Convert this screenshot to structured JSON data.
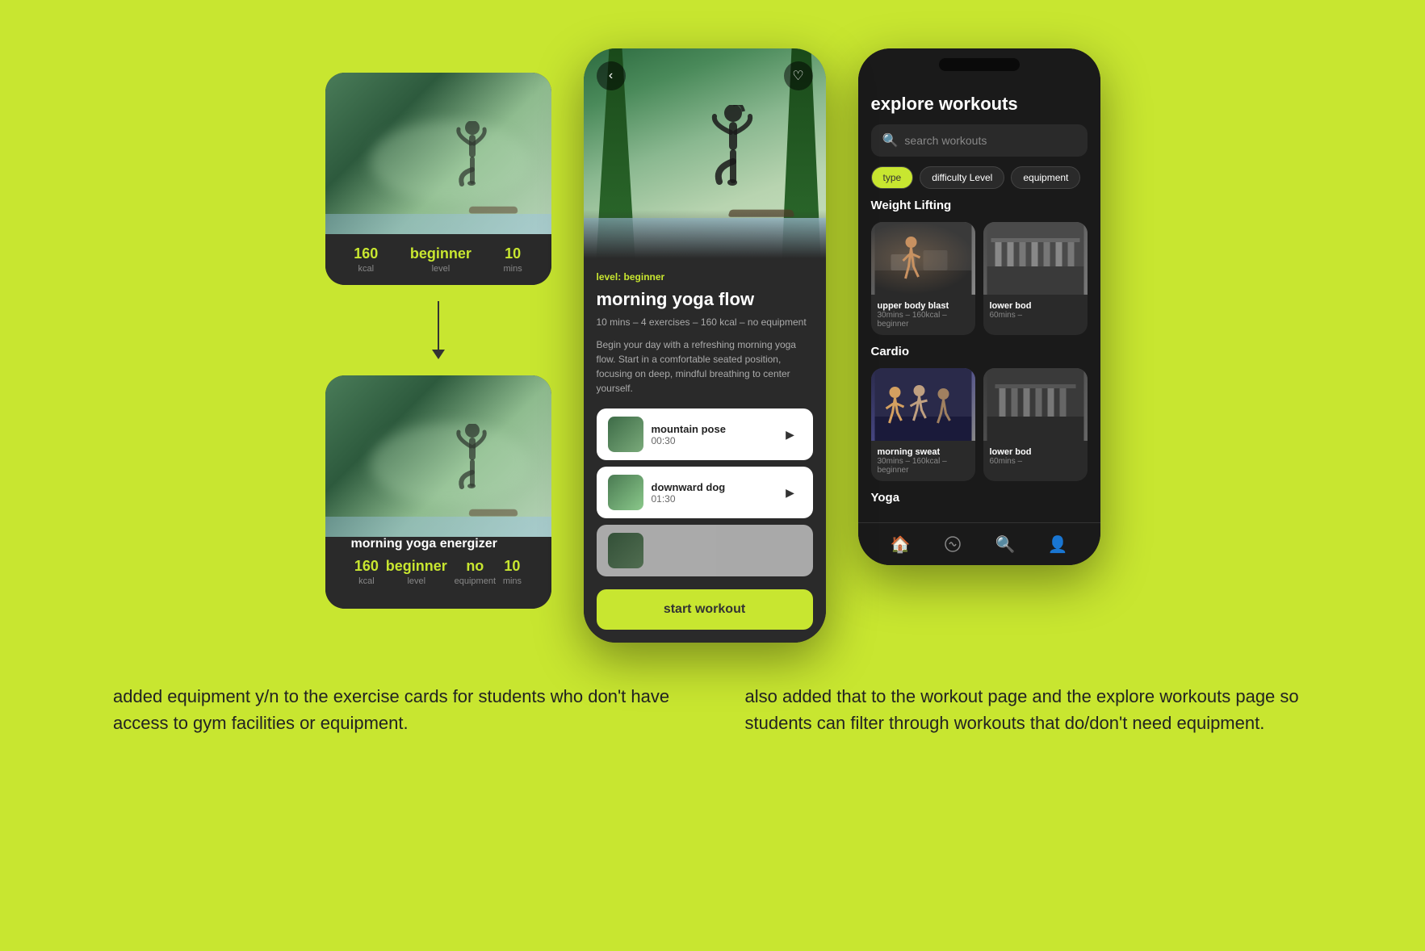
{
  "background_color": "#c8e630",
  "left_card_1": {
    "stats": [
      {
        "value": "160",
        "label": "kcal"
      },
      {
        "value": "beginner",
        "label": "level",
        "is_accent": true
      },
      {
        "value": "10",
        "label": "mins"
      }
    ]
  },
  "arrow": {
    "direction": "down"
  },
  "left_card_2": {
    "title": "morning yoga energizer",
    "stats": [
      {
        "value": "160",
        "label": "kcal"
      },
      {
        "value": "beginner",
        "label": "level",
        "is_accent": true
      },
      {
        "value": "no",
        "label": "equipment"
      },
      {
        "value": "10",
        "label": "mins"
      }
    ]
  },
  "middle_phone": {
    "back_button": "‹",
    "heart_icon": "♡",
    "level_tag": "level: beginner",
    "workout_title": "morning yoga flow",
    "workout_meta": "10 mins – 4 exercises – 160 kcal – no equipment",
    "workout_desc": "Begin your day with a refreshing morning yoga flow. Start in a comfortable seated position, focusing on deep, mindful breathing to center yourself.",
    "exercises": [
      {
        "name": "mountain pose",
        "duration": "00:30"
      },
      {
        "name": "downward dog",
        "duration": "01:30"
      }
    ],
    "start_button_label": "start workout"
  },
  "right_phone": {
    "notch": true,
    "explore_title": "explore workouts",
    "search_placeholder": "search workouts",
    "filter_chips": [
      {
        "label": "type",
        "active": true
      },
      {
        "label": "difficulty Level",
        "active": false
      },
      {
        "label": "equipment",
        "active": false
      }
    ],
    "sections": [
      {
        "label": "Weight Lifting",
        "items": [
          {
            "name": "upper body blast",
            "meta": "30mins – 160kcal – beginner"
          },
          {
            "name": "lower bod",
            "meta": "60mins –"
          }
        ]
      },
      {
        "label": "Cardio",
        "items": [
          {
            "name": "morning sweat",
            "meta": "30mins – 160kcal – beginner"
          },
          {
            "name": "lower bod",
            "meta": "60mins –"
          }
        ]
      },
      {
        "label": "Yoga",
        "items": []
      }
    ],
    "nav_icons": [
      "🏠",
      "🤸",
      "🔍",
      "👤"
    ],
    "nav_active": 0,
    "nav_search_active": 2
  },
  "bottom_texts": [
    "added equipment y/n to the exercise cards for students who don't have access to gym facilities or equipment.",
    "also added that to the workout page and the explore workouts page so students can filter through workouts that do/don't need equipment."
  ]
}
